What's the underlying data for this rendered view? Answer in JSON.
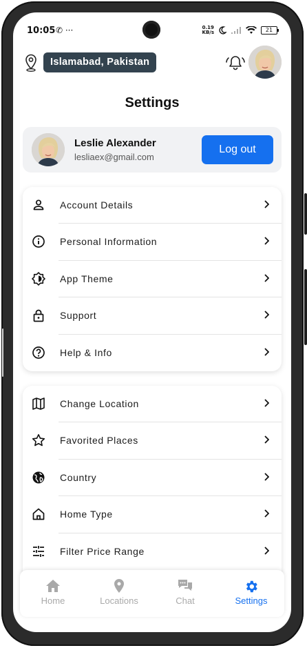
{
  "status_bar": {
    "time": "10:05",
    "left_icons": "✆ ···",
    "net_speed_top": "0.19",
    "net_speed_bottom": "KB/s",
    "battery": "21"
  },
  "header": {
    "location": "Islamabad, Pakistan"
  },
  "page": {
    "title": "Settings"
  },
  "profile": {
    "name": "Leslie Alexander",
    "email": "lesliaex@gmail.com",
    "logout_label": "Log out"
  },
  "group1": [
    {
      "label": "Account Details",
      "icon": "person-icon"
    },
    {
      "label": "Personal Information",
      "icon": "info-icon"
    },
    {
      "label": "App Theme",
      "icon": "brightness-icon"
    },
    {
      "label": "Support",
      "icon": "lock-icon"
    },
    {
      "label": "Help & Info",
      "icon": "help-icon"
    }
  ],
  "group2": [
    {
      "label": "Change Location",
      "icon": "map-icon"
    },
    {
      "label": "Favorited Places",
      "icon": "star-icon"
    },
    {
      "label": "Country",
      "icon": "globe-icon"
    },
    {
      "label": "Home Type",
      "icon": "home-outline-icon"
    },
    {
      "label": "Filter Price Range",
      "icon": "sliders-icon"
    }
  ],
  "bottom_nav": [
    {
      "label": "Home",
      "icon": "home-icon"
    },
    {
      "label": "Locations",
      "icon": "location-pin-icon"
    },
    {
      "label": "Chat",
      "icon": "chat-icon"
    },
    {
      "label": "Settings",
      "icon": "gear-icon",
      "active": true
    }
  ],
  "colors": {
    "accent": "#1570ef",
    "chip": "#33434f",
    "inactive": "#a9a9a9"
  }
}
